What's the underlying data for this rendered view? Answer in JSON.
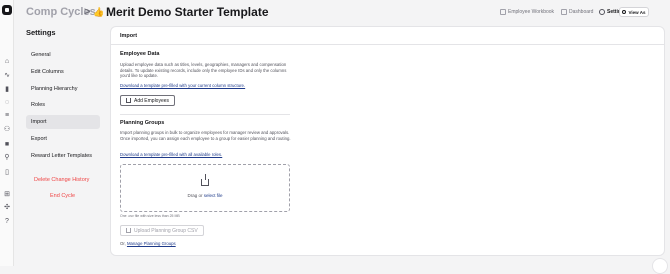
{
  "rail": {
    "icons": [
      "home-icon",
      "activity-icon",
      "chart-icon",
      "lightbulb-icon",
      "database-icon",
      "users-icon",
      "grid-icon",
      "user-search-icon",
      "file-icon",
      "grid-small-icon",
      "puzzle-icon",
      "help-icon"
    ]
  },
  "header": {
    "breadcrumb_parent": "Comp Cycles",
    "separator": ">",
    "cycle_name": "Merit Demo Starter Template",
    "nav": {
      "employee_workbook": "Employee Workbook",
      "dashboard": "Dashboard",
      "settings": "Settings",
      "view_as": "View As"
    }
  },
  "sidebar": {
    "title": "Settings",
    "items": [
      {
        "label": "General"
      },
      {
        "label": "Edit Columns"
      },
      {
        "label": "Planning Hierarchy"
      },
      {
        "label": "Roles"
      },
      {
        "label": "Import"
      },
      {
        "label": "Export"
      },
      {
        "label": "Reward Letter Templates"
      }
    ],
    "delete_change_history": "Delete Change History",
    "end_cycle": "End Cycle"
  },
  "main": {
    "section_title": "Import",
    "employee_data": {
      "title": "Employee Data",
      "description": "Upload employee data such as titles, levels, geographies, managers and compensation details. To update existing records, include only the employee IDs and only the columns you'd like to update.",
      "template_link": "Download a template pre-filled with your current column structure.",
      "button": "Add Employees"
    },
    "planning_groups": {
      "title": "Planning Groups",
      "description": "Import planning groups in bulk to organize employees for manager review and approvals. Once imported, you can assign each employee to a group for easier planning and routing.",
      "template_link": "Download a template pre-filled with all available roles.",
      "drop_text": "Drag or",
      "drop_select": "select file",
      "file_limit": "One .csv file with size less than 25 MB",
      "upload_button": "Upload Planning Group CSV",
      "or_text": "Or,",
      "manage_link": "Manage Planning Groups"
    }
  },
  "colors": {
    "accent": "#1e3a8a",
    "danger": "#ef4444",
    "active_nav": "#e4e4e7"
  }
}
